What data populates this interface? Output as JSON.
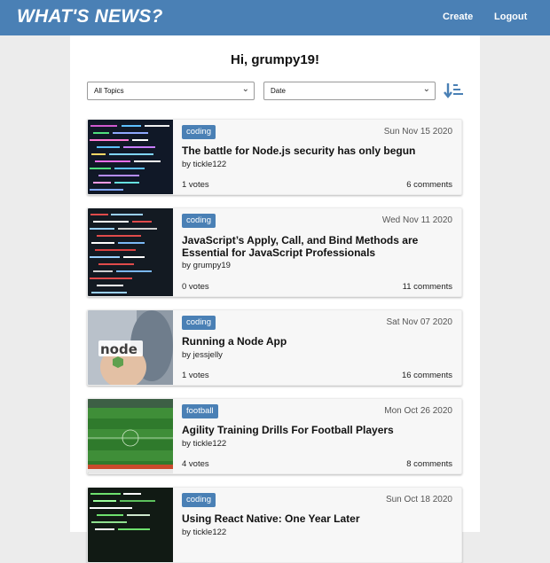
{
  "header": {
    "brand": "WHAT'S NEWS?",
    "create_label": "Create",
    "logout_label": "Logout",
    "color": "#4a80b5"
  },
  "main": {
    "greeting": "Hi, grumpy19!",
    "topic_filter": "All Topics",
    "sort_by": "Date",
    "sort_icon": "sort-descending-icon"
  },
  "articles": [
    {
      "topic": "coding",
      "date": "Sun Nov 15 2020",
      "title": "The battle for Node.js security has only begun",
      "author": "by tickle122",
      "votes": "1 votes",
      "comments": "6 comments"
    },
    {
      "topic": "coding",
      "date": "Wed Nov 11 2020",
      "title": "JavaScript’s Apply, Call, and Bind Methods are Essential for JavaScript Professionals",
      "author": "by grumpy19",
      "votes": "0 votes",
      "comments": "11 comments"
    },
    {
      "topic": "coding",
      "date": "Sat Nov 07 2020",
      "title": "Running a Node App",
      "author": "by jessjelly",
      "votes": "1 votes",
      "comments": "16 comments"
    },
    {
      "topic": "football",
      "date": "Mon Oct 26 2020",
      "title": "Agility Training Drills For Football Players",
      "author": "by tickle122",
      "votes": "4 votes",
      "comments": "8 comments"
    },
    {
      "topic": "coding",
      "date": "Sun Oct 18 2020",
      "title": "Using React Native: One Year Later",
      "author": "by tickle122",
      "votes": "",
      "comments": ""
    }
  ]
}
